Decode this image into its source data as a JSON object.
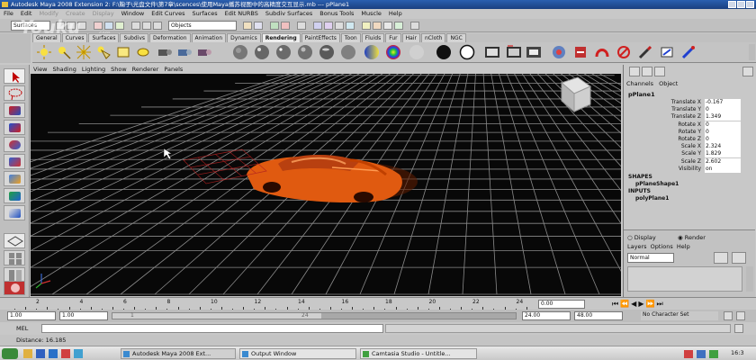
{
  "window": {
    "title": "Autodesk Maya 2008 Extension 2: F:\\鞠子\\光盘文件\\第7章\\scences\\使用Maya播苏视图中的高精度交互显示.mb  ---  pPlane1"
  },
  "menubar": [
    "File",
    "Edit",
    "Modify",
    "Create",
    "Display",
    "Window",
    "Edit Curves",
    "Surfaces",
    "Edit NURBS",
    "Subdiv Surfaces",
    "Bonus Tools",
    "Muscle",
    "Help"
  ],
  "statusline": {
    "mode": "Surfaces",
    "object_select": "Objects"
  },
  "watermark": {
    "text": "Youku",
    "sub": ".com"
  },
  "shelf_tabs": [
    "General",
    "Curves",
    "Surfaces",
    "Subdivs",
    "Deformation",
    "Animation",
    "Dynamics",
    "Rendering",
    "PaintEffects",
    "Toon",
    "Fluids",
    "Fur",
    "Hair",
    "nCloth",
    "NGC"
  ],
  "shelf_active": "Rendering",
  "panel_menu": [
    "View",
    "Shading",
    "Lighting",
    "Show",
    "Renderer",
    "Panels"
  ],
  "channel_box": {
    "menu": [
      "Channels",
      "Object"
    ],
    "object": "pPlane1",
    "attributes": [
      {
        "name": "Translate X",
        "value": "-0.167"
      },
      {
        "name": "Translate Y",
        "value": "0"
      },
      {
        "name": "Translate Z",
        "value": "1.349"
      },
      {
        "name": "Rotate X",
        "value": "0"
      },
      {
        "name": "Rotate Y",
        "value": "0"
      },
      {
        "name": "Rotate Z",
        "value": "0"
      },
      {
        "name": "Scale X",
        "value": "2.324"
      },
      {
        "name": "Scale Y",
        "value": "1.829"
      },
      {
        "name": "Scale Z",
        "value": "2.602"
      },
      {
        "name": "Visibility",
        "value": "on"
      }
    ],
    "shapes_label": "SHAPES",
    "shape_node": "pPlaneShape1",
    "inputs_label": "INPUTS",
    "input_node": "polyPlane1"
  },
  "layers": {
    "display_label": "Display",
    "render_label": "Render",
    "menu": [
      "Layers",
      "Options",
      "Help"
    ],
    "blend_mode": "Normal"
  },
  "timeline": {
    "ticks": [
      "2",
      "4",
      "6",
      "8",
      "10",
      "12",
      "14",
      "16",
      "18",
      "20",
      "22",
      "24"
    ],
    "current_frame": "0.00"
  },
  "range": {
    "start": "1.00",
    "playback_start": "1.00",
    "range_left": "1",
    "range_right": "24",
    "playback_end": "24.00",
    "end": "48.00",
    "character_set": "No Character Set"
  },
  "mel": {
    "label": "MEL"
  },
  "help_line": "Distance: 16.185",
  "taskbar": {
    "items": [
      "Autodesk Maya 2008 Ext...",
      "Output Window",
      "Camtasia Studio - Untitle..."
    ],
    "clock": "16:3"
  },
  "colors": {
    "title_blue": "#2a5fb0",
    "car_orange": "#e05a10",
    "grid": "#9a9a9a",
    "viewport_bg": "#080808",
    "view_cube": "#c8c8c8"
  }
}
